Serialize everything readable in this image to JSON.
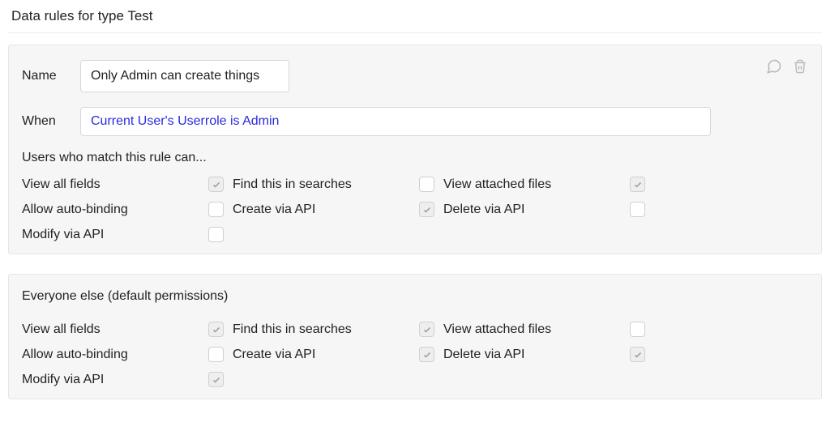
{
  "pageTitle": "Data rules for type Test",
  "rule1": {
    "nameLabel": "Name",
    "nameValue": "Only Admin can create things",
    "whenLabel": "When",
    "whenValue": "Current User's Userrole is Admin",
    "subheading": "Users who match this rule can...",
    "permissions": {
      "view_all_fields": {
        "label": "View all fields",
        "checked": true
      },
      "find_in_searches": {
        "label": "Find this in searches",
        "checked": false
      },
      "view_attached_files": {
        "label": "View attached files",
        "checked": true
      },
      "allow_auto_binding": {
        "label": "Allow auto-binding",
        "checked": false
      },
      "create_via_api": {
        "label": "Create via API",
        "checked": true
      },
      "delete_via_api": {
        "label": "Delete via API",
        "checked": false
      },
      "modify_via_api": {
        "label": "Modify via API",
        "checked": false
      }
    }
  },
  "defaults": {
    "subheading": "Everyone else (default permissions)",
    "permissions": {
      "view_all_fields": {
        "label": "View all fields",
        "checked": true
      },
      "find_in_searches": {
        "label": "Find this in searches",
        "checked": true
      },
      "view_attached_files": {
        "label": "View attached files",
        "checked": false
      },
      "allow_auto_binding": {
        "label": "Allow auto-binding",
        "checked": false
      },
      "create_via_api": {
        "label": "Create via API",
        "checked": true
      },
      "delete_via_api": {
        "label": "Delete via API",
        "checked": true
      },
      "modify_via_api": {
        "label": "Modify via API",
        "checked": true
      }
    }
  }
}
